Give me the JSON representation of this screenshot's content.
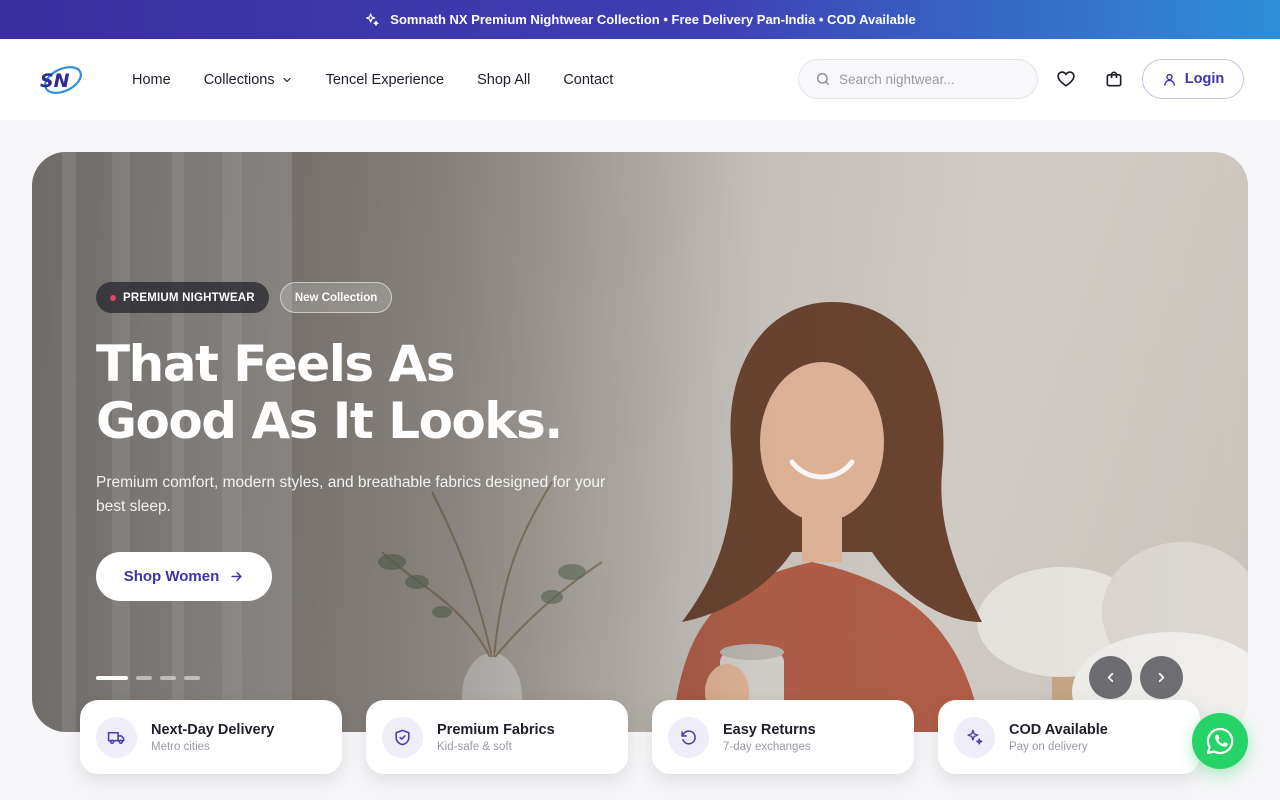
{
  "announcement": {
    "text": "Somnath NX Premium Nightwear Collection • Free Delivery Pan-India • COD Available",
    "icon": "sparkles-icon"
  },
  "header": {
    "logo_text": "SN",
    "nav": [
      {
        "label": "Home"
      },
      {
        "label": "Collections",
        "has_dropdown": true
      },
      {
        "label": "Tencel Experience"
      },
      {
        "label": "Shop All"
      },
      {
        "label": "Contact"
      }
    ],
    "search": {
      "placeholder": "Search nightwear...",
      "value": ""
    },
    "login_label": "Login"
  },
  "hero": {
    "badge_primary": "PREMIUM NIGHTWEAR",
    "badge_secondary": "New Collection",
    "headline_line1": "That Feels As",
    "headline_line2": "Good As It Looks.",
    "subheadline": "Premium comfort, modern styles, and breathable fabrics designed for your best sleep.",
    "cta_label": "Shop Women",
    "slides_total": 4,
    "active_slide": 1
  },
  "features": [
    {
      "title": "Next-Day Delivery",
      "subtitle": "Metro cities",
      "icon": "truck-icon"
    },
    {
      "title": "Premium Fabrics",
      "subtitle": "Kid-safe & soft",
      "icon": "shield-icon"
    },
    {
      "title": "Easy Returns",
      "subtitle": "7-day exchanges",
      "icon": "rotate-ccw-icon"
    },
    {
      "title": "COD Available",
      "subtitle": "Pay on delivery",
      "icon": "sparkles-icon"
    }
  ],
  "colors": {
    "brand": "#3f33a6",
    "accent_dot": "#e0456a",
    "whatsapp": "#25d366"
  }
}
